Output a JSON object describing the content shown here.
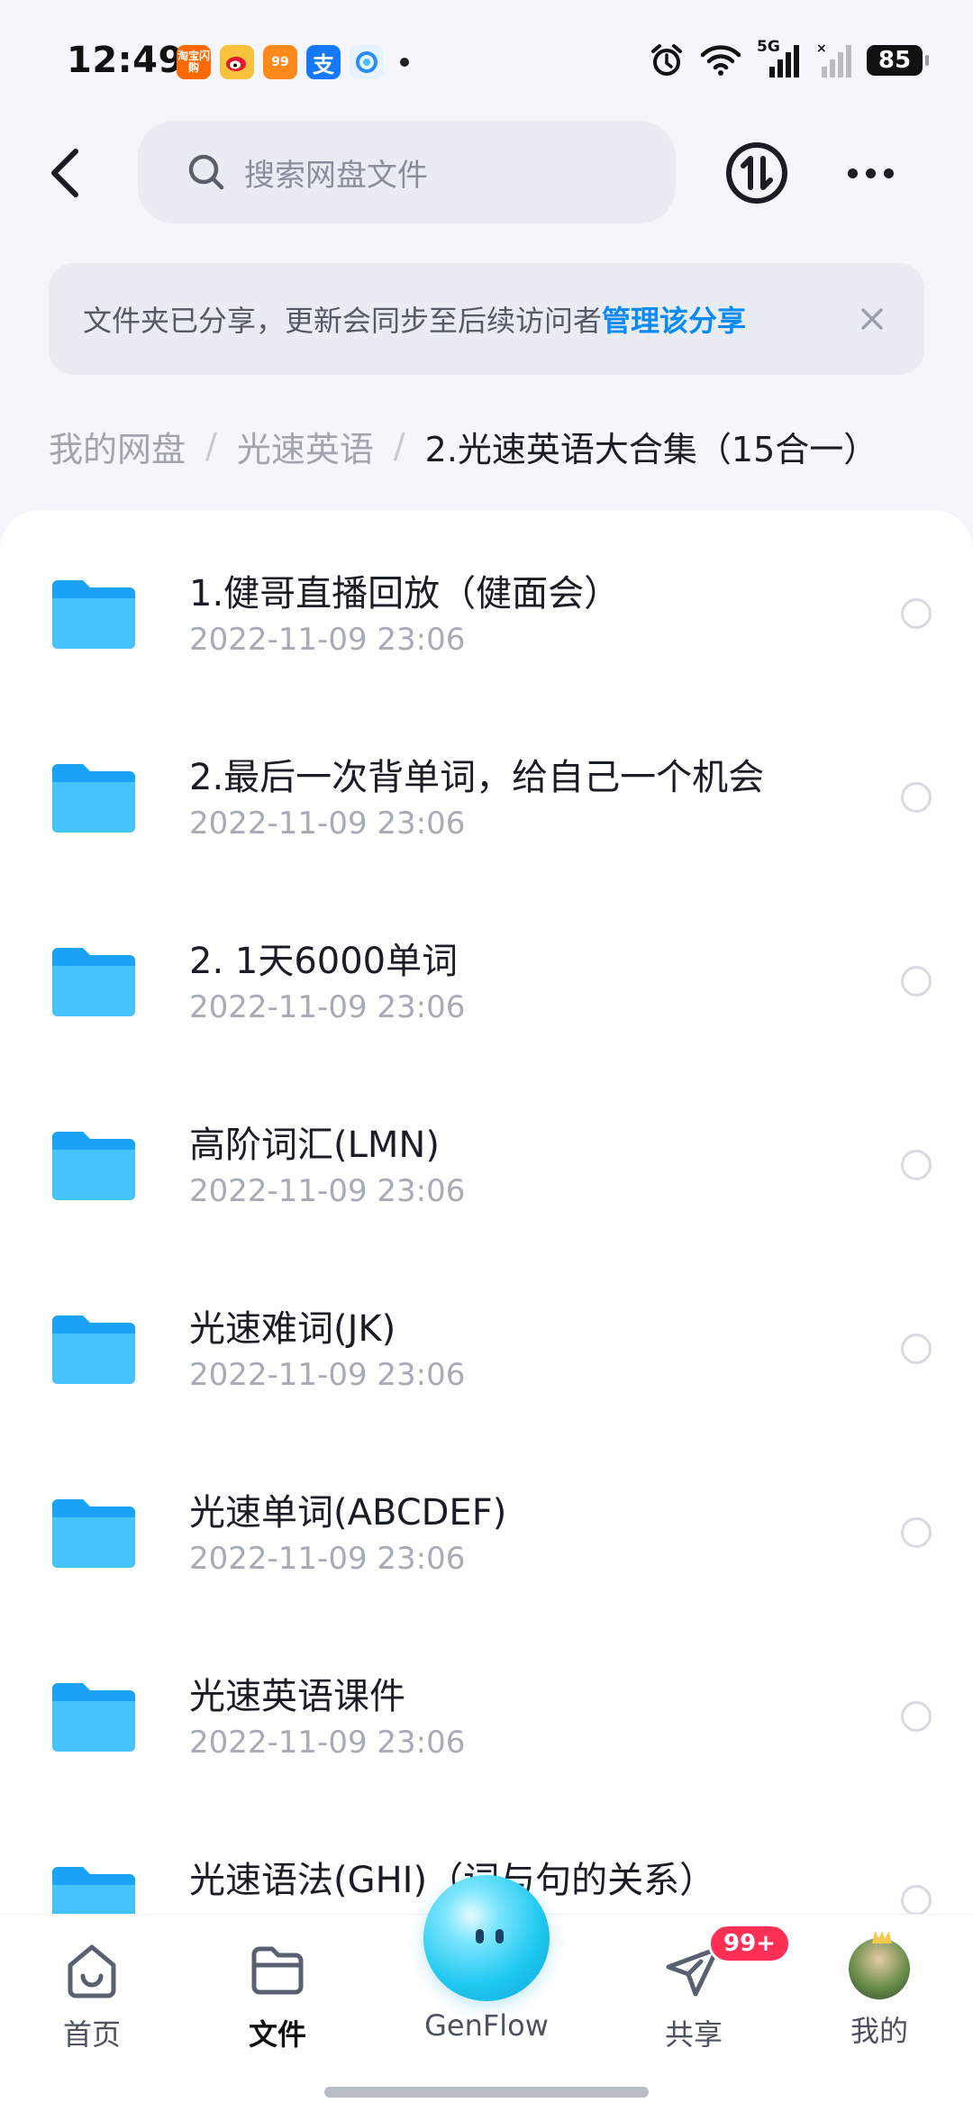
{
  "status_bar": {
    "time": "12:49",
    "battery": "85",
    "network": "5G",
    "notification_icons": [
      "taobao-icon",
      "weibo-icon",
      "pinduoduo-icon",
      "alipay-icon",
      "qq-browser-icon"
    ],
    "notification_icon_texts": {
      "taobao": "淘宝闪购",
      "pdd": "99",
      "alipay": "支"
    }
  },
  "header": {
    "search_placeholder": "搜索网盘文件"
  },
  "banner": {
    "text": "文件夹已分享，更新会同步至后续访问者",
    "link": "管理该分享"
  },
  "breadcrumb": {
    "items": [
      "我的网盘",
      "光速英语",
      "2.光速英语大合集（15合一）"
    ],
    "separator": "/"
  },
  "files": [
    {
      "name": "1.健哥直播回放（健面会）",
      "date": "2022-11-09  23:06"
    },
    {
      "name": "2.最后一次背单词，给自己一个机会",
      "date": "2022-11-09  23:06"
    },
    {
      "name": "2. 1天6000单词",
      "date": "2022-11-09  23:06"
    },
    {
      "name": "高阶词汇(LMN)",
      "date": "2022-11-09  23:06"
    },
    {
      "name": "光速难词(JK)",
      "date": "2022-11-09  23:06"
    },
    {
      "name": "光速单词(ABCDEF)",
      "date": "2022-11-09  23:06"
    },
    {
      "name": "光速英语课件",
      "date": "2022-11-09  23:06"
    },
    {
      "name": "光速语法(GHI)（词与句的关系）",
      "date": ""
    }
  ],
  "bottom_nav": {
    "home": "首页",
    "files": "文件",
    "genflow": "GenFlow",
    "share": "共享",
    "share_badge": "99+",
    "mine": "我的",
    "active": "files"
  },
  "colors": {
    "accent": "#0a8af5",
    "folder": "#35b8fb",
    "badge": "#ff2f55"
  }
}
